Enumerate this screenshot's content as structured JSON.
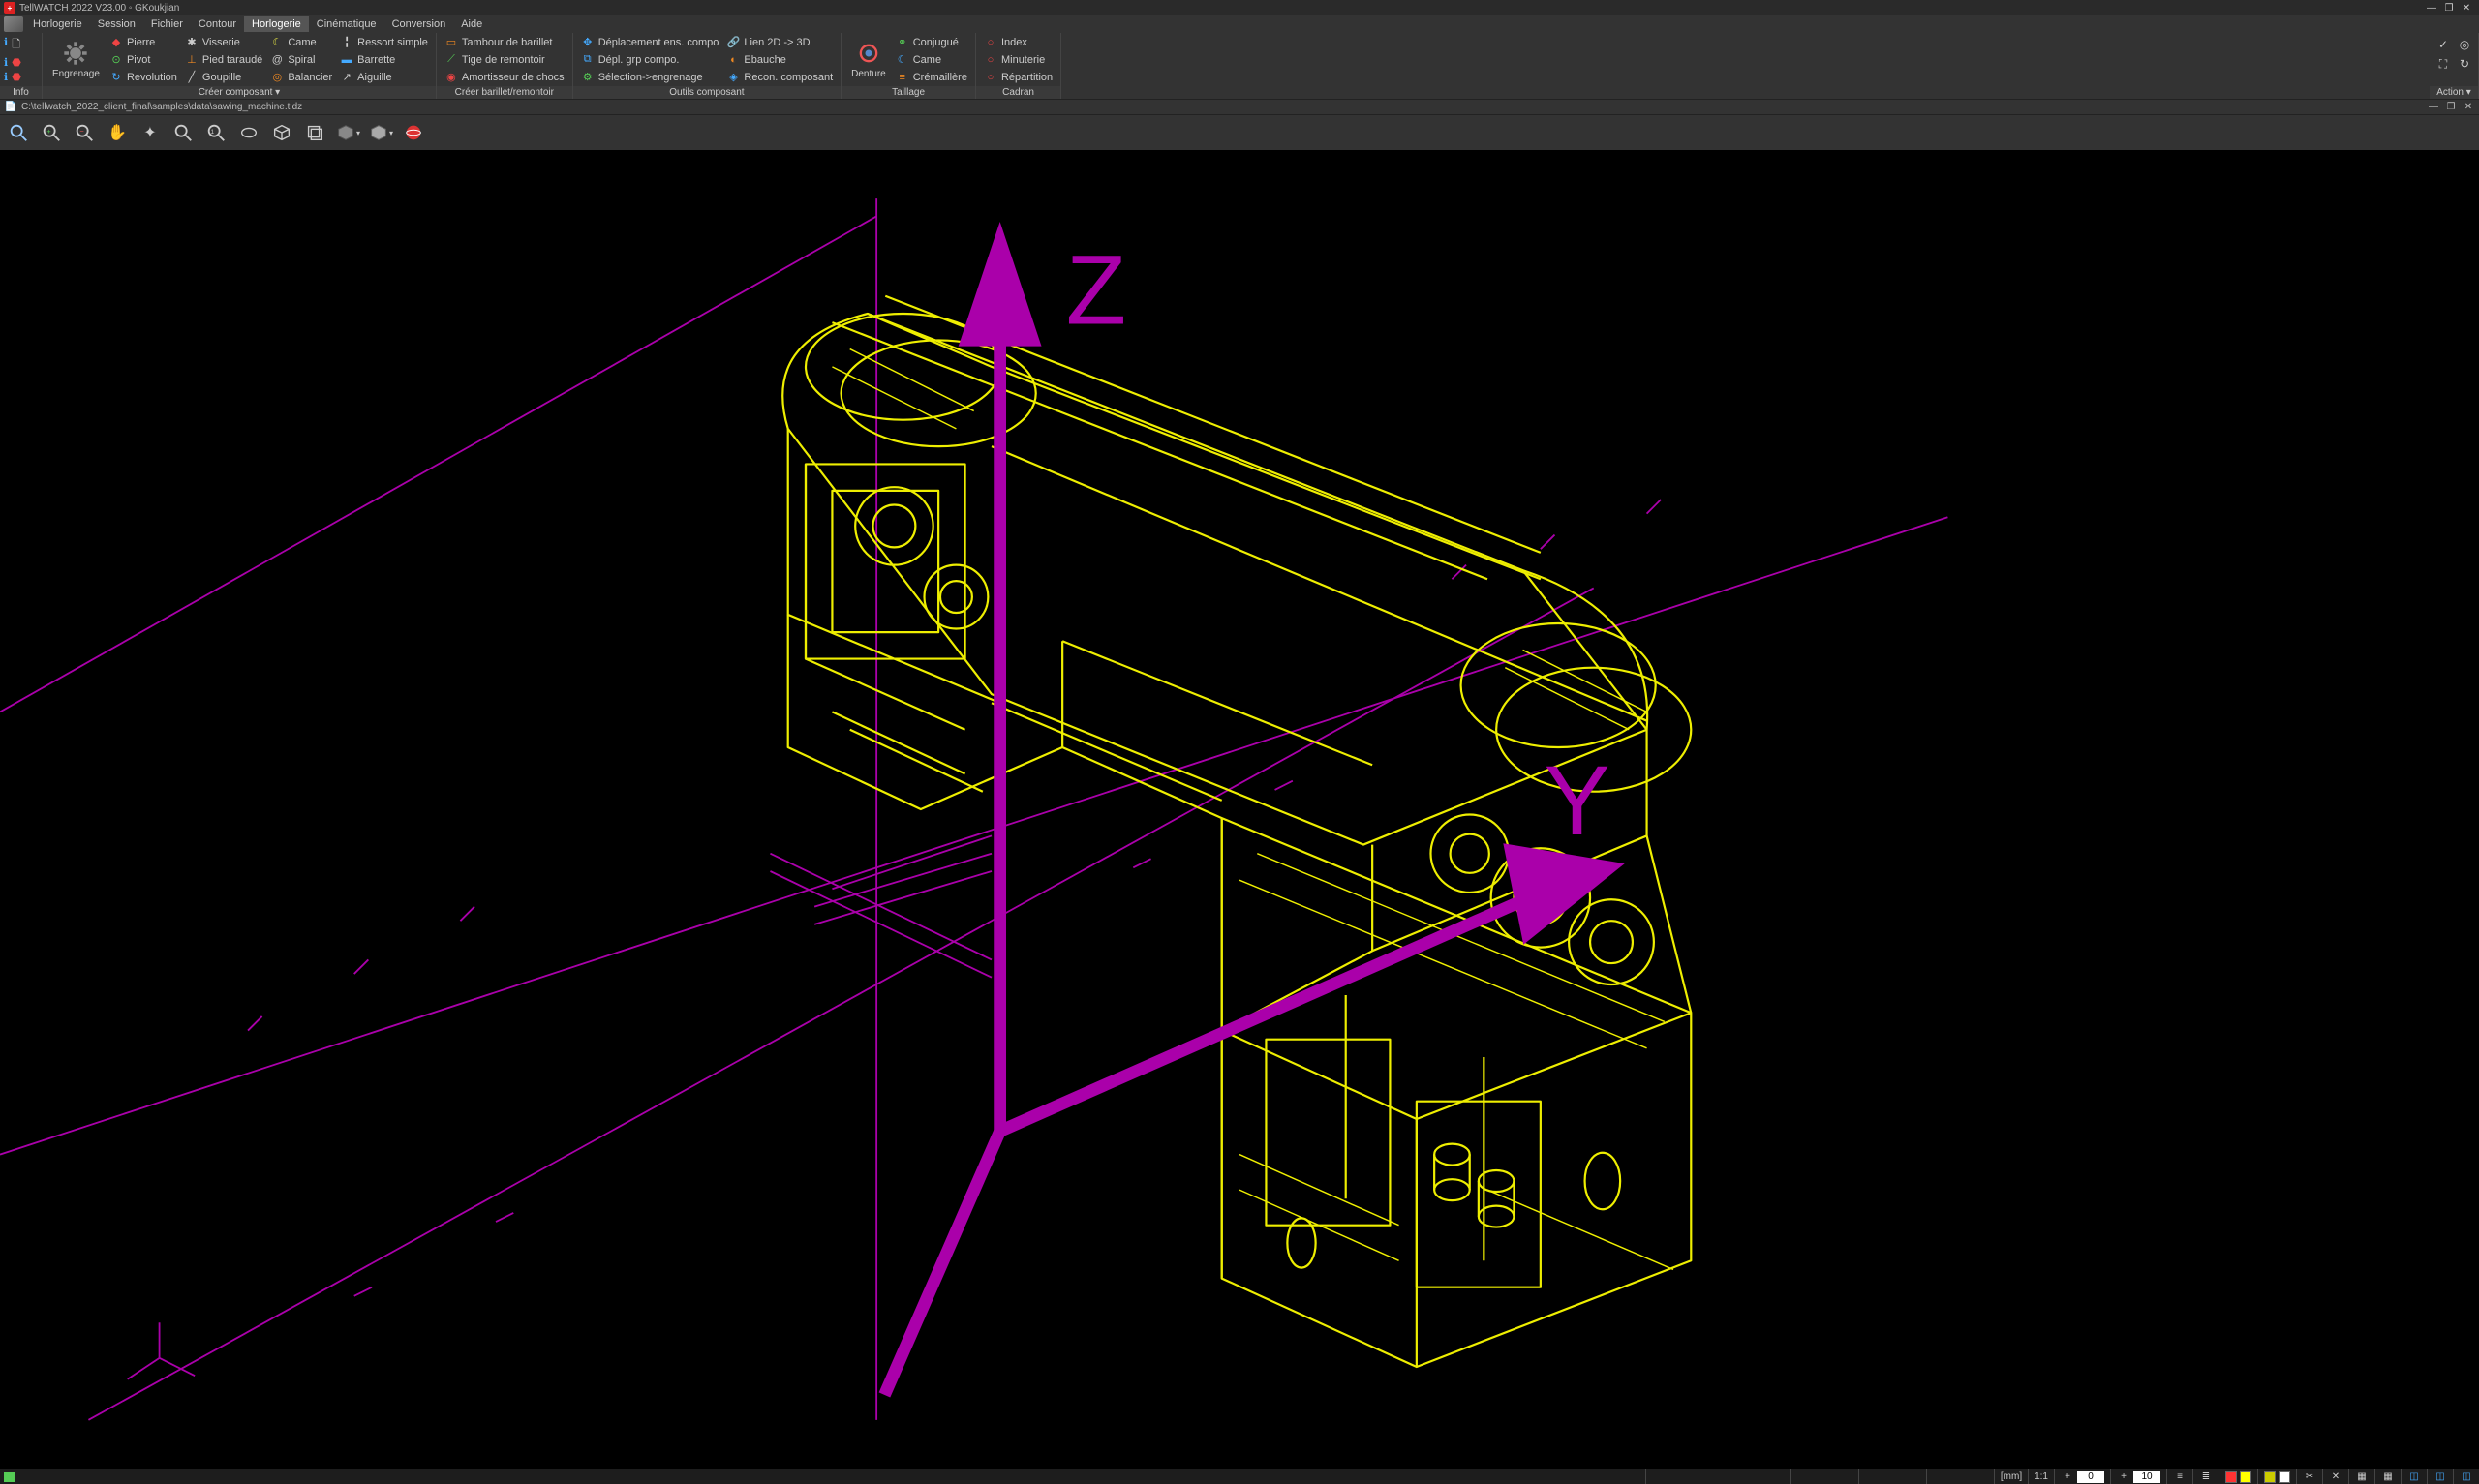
{
  "title": "TellWATCH 2022 V23.00 ◦ GKoukjian",
  "menubar": [
    "Horlogerie",
    "Session",
    "Fichier",
    "Contour",
    "Horlogerie",
    "Cinématique",
    "Conversion",
    "Aide"
  ],
  "menubar_active_index": 4,
  "ribbon": {
    "groups": [
      {
        "name": "Info",
        "label": "Info",
        "big": null,
        "cols": []
      },
      {
        "name": "CreerComposant",
        "label": "Créer composant ▾",
        "big": {
          "icon": "gear",
          "label": "Engrenage"
        },
        "cols": [
          [
            {
              "icon": "jewel",
              "label": "Pierre"
            },
            {
              "icon": "pivot",
              "label": "Pivot"
            },
            {
              "icon": "revolution",
              "label": "Revolution"
            }
          ],
          [
            {
              "icon": "screw",
              "label": "Visserie"
            },
            {
              "icon": "foot",
              "label": "Pied taraudé"
            },
            {
              "icon": "pin",
              "label": "Goupille"
            }
          ],
          [
            {
              "icon": "cam",
              "label": "Came"
            },
            {
              "icon": "spiral",
              "label": "Spiral"
            },
            {
              "icon": "balance",
              "label": "Balancier"
            }
          ],
          [
            {
              "icon": "spring",
              "label": "Ressort simple"
            },
            {
              "icon": "bar",
              "label": "Barrette"
            },
            {
              "icon": "needle",
              "label": "Aiguille"
            }
          ]
        ]
      },
      {
        "name": "CreerBarillet",
        "label": "Créer barillet/remontoir",
        "cols": [
          [
            {
              "icon": "drum",
              "label": "Tambour de barillet"
            },
            {
              "icon": "stem",
              "label": "Tige de remontoir"
            },
            {
              "icon": "shock",
              "label": "Amortisseur de chocs"
            }
          ]
        ]
      },
      {
        "name": "OutilsComposant",
        "label": "Outils composant",
        "cols": [
          [
            {
              "icon": "move",
              "label": "Déplacement ens. compo"
            },
            {
              "icon": "movegrp",
              "label": "Dépl. grp compo."
            },
            {
              "icon": "sel",
              "label": "Sélection->engrenage"
            }
          ],
          [
            {
              "icon": "link",
              "label": "Lien 2D -> 3D"
            },
            {
              "icon": "blank",
              "label": "Ebauche"
            },
            {
              "icon": "recon",
              "label": "Recon. composant"
            }
          ]
        ]
      },
      {
        "name": "Taillage",
        "label": "Taillage",
        "big": {
          "icon": "cutter",
          "label": "Denture"
        },
        "cols": [
          [
            {
              "icon": "conj",
              "label": "Conjugué"
            },
            {
              "icon": "cam2",
              "label": "Came"
            },
            {
              "icon": "rack",
              "label": "Crémaillère"
            }
          ]
        ]
      },
      {
        "name": "Cadran",
        "label": "Cadran",
        "cols": [
          [
            {
              "icon": "index",
              "label": "Index"
            },
            {
              "icon": "minute",
              "label": "Minuterie"
            },
            {
              "icon": "repart",
              "label": "Répartition"
            }
          ]
        ]
      }
    ],
    "actions_label": "Action ▾"
  },
  "pathbar": "C:\\tellwatch_2022_client_final\\samples\\data\\sawing_machine.tldz",
  "viewtoolbar": [
    "zoom-fit",
    "zoom-in",
    "zoom-out",
    "pan",
    "rotate",
    "zoom-window",
    "zoom-prev",
    "zoom-region",
    "box-3d",
    "cube-wire",
    "cube-drop",
    "cube-solid",
    "sphere-red"
  ],
  "status": {
    "unit": "[mm]",
    "ratio": "1:1",
    "val1": "0",
    "val2": "10"
  }
}
